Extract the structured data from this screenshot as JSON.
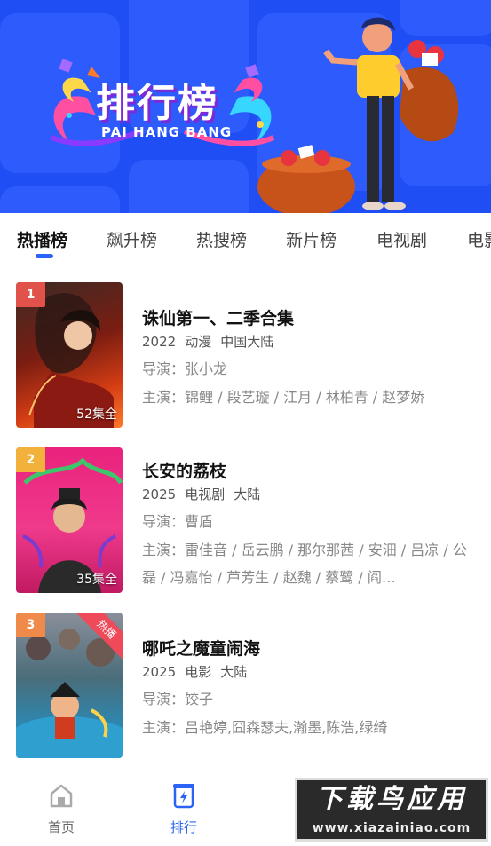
{
  "banner": {
    "title": "排行榜",
    "subtitle": "PAI HANG BANG",
    "bg_color": "#1f4ef5"
  },
  "tabs": [
    {
      "label": "热播榜",
      "active": true
    },
    {
      "label": "飙升榜",
      "active": false
    },
    {
      "label": "热搜榜",
      "active": false
    },
    {
      "label": "新片榜",
      "active": false
    },
    {
      "label": "电视剧",
      "active": false
    },
    {
      "label": "电影",
      "active": false
    }
  ],
  "accent_color": "#2a63f5",
  "items": [
    {
      "rank": "1",
      "rank_color": "#e0524a",
      "title": "诛仙第一、二季合集",
      "year": "2022",
      "genre": "动漫",
      "region": "中国大陆",
      "director_label": "导演：",
      "director": "张小龙",
      "cast_label": "主演：",
      "cast": "锦鲤 / 段艺璇 / 江月 / 林柏青 / 赵梦娇",
      "episodes": "52集全"
    },
    {
      "rank": "2",
      "rank_color": "#f2b13a",
      "title": "长安的荔枝",
      "year": "2025",
      "genre": "电视剧",
      "region": "大陆",
      "director_label": "导演：",
      "director": "曹盾",
      "cast_label": "主演：",
      "cast": "雷佳音 / 岳云鹏 / 那尔那茜 / 安沺 / 吕凉 / 公磊 / 冯嘉怡 / 芦芳生 / 赵魏 / 蔡鹭 / 阎…",
      "episodes": "35集全"
    },
    {
      "rank": "3",
      "rank_color": "#f08a4b",
      "title": "哪吒之魔童闹海",
      "year": "2025",
      "genre": "电影",
      "region": "大陆",
      "director_label": "导演：",
      "director": "饺子",
      "cast_label": "主演：",
      "cast": "吕艳婷,囧森瑟夫,瀚墨,陈浩,绿绮",
      "corner_tag": "热播"
    }
  ],
  "bottom_nav": [
    {
      "label": "首页",
      "icon": "home-icon",
      "active": false
    },
    {
      "label": "排行",
      "icon": "ranking-icon",
      "active": true
    }
  ],
  "watermark": {
    "line1": "下载鸟应用",
    "line2": "www.xiazainiao.com"
  }
}
